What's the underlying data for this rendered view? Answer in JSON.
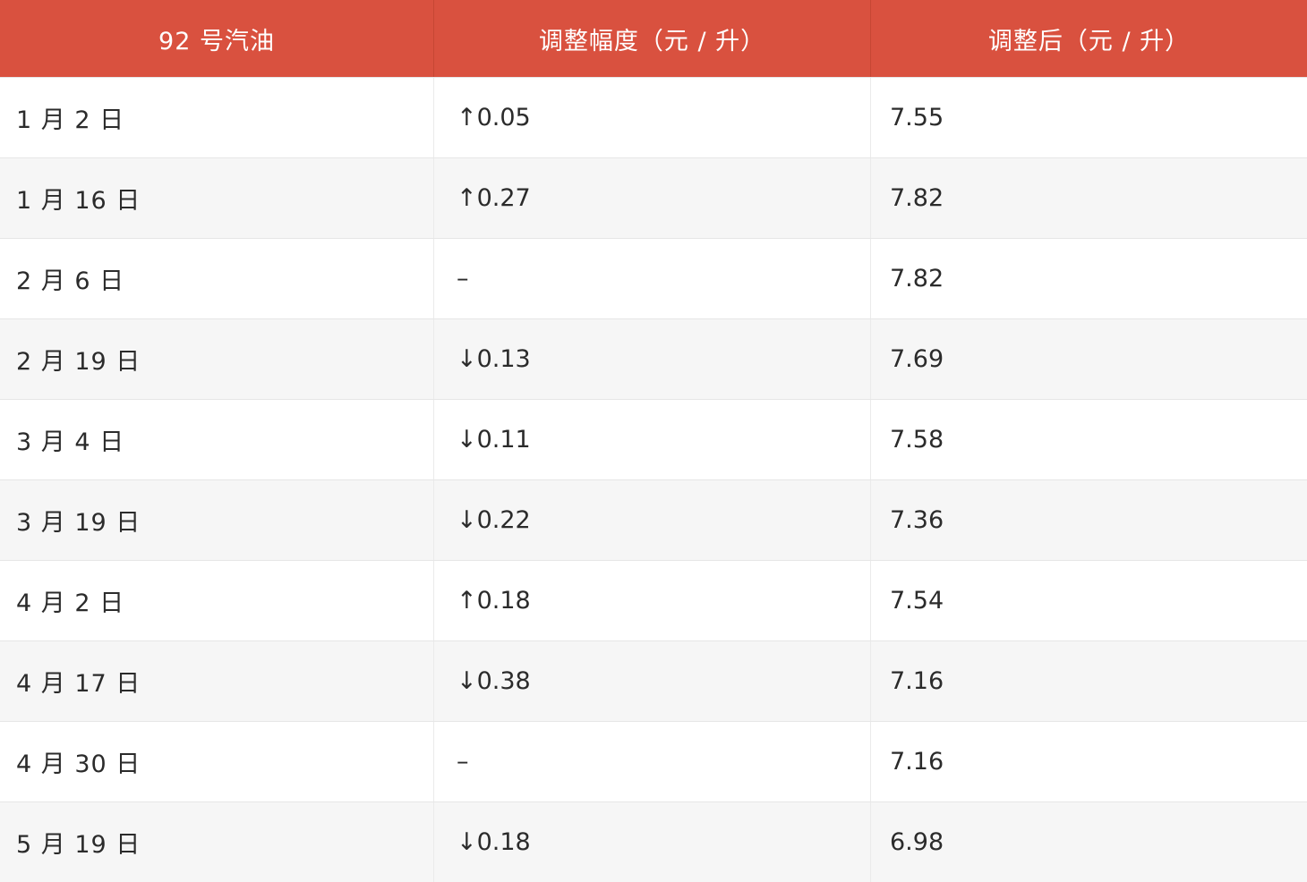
{
  "table": {
    "headers": [
      "92 号汽油",
      "调整幅度（元 / 升）",
      "调整后（元 / 升）"
    ],
    "rows": [
      {
        "date": "1 月 2 日",
        "change": "↑0.05",
        "price": "7.55"
      },
      {
        "date": "1 月 16 日",
        "change": "↑0.27",
        "price": "7.82"
      },
      {
        "date": "2 月 6 日",
        "change": "–",
        "price": "7.82"
      },
      {
        "date": "2 月 19 日",
        "change": "↓0.13",
        "price": "7.69"
      },
      {
        "date": "3 月 4 日",
        "change": "↓0.11",
        "price": "7.58"
      },
      {
        "date": "3 月 19 日",
        "change": "↓0.22",
        "price": "7.36"
      },
      {
        "date": "4 月 2 日",
        "change": "↑0.18",
        "price": "7.54"
      },
      {
        "date": "4 月 17 日",
        "change": "↓0.38",
        "price": "7.16"
      },
      {
        "date": "4 月 30 日",
        "change": "–",
        "price": "7.16"
      },
      {
        "date": "5 月 19 日",
        "change": "↓0.18",
        "price": "6.98"
      }
    ]
  },
  "colors": {
    "header_background": "#d9513f",
    "header_text": "#ffffff",
    "row_alt_background": "#f6f6f6",
    "body_text": "#2b2b2b"
  }
}
